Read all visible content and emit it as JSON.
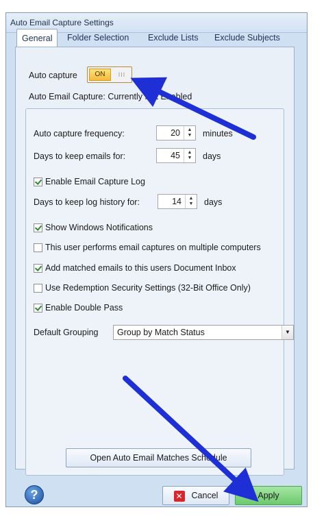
{
  "window": {
    "title": "Auto Email Capture Settings"
  },
  "tabs": [
    {
      "label": "General",
      "active": true
    },
    {
      "label": "Folder Selection",
      "active": false
    },
    {
      "label": "Exclude Lists",
      "active": false
    },
    {
      "label": "Exclude Subjects",
      "active": false
    }
  ],
  "general": {
    "auto_capture_label": "Auto capture",
    "toggle": {
      "on_label": "ON",
      "off_label": "III",
      "state": "on"
    },
    "status_text": "Auto Email Capture: Currently Not Enabled",
    "frequency": {
      "label": "Auto capture frequency:",
      "value": "20",
      "unit": "minutes"
    },
    "days_keep_emails": {
      "label": "Days to keep emails for:",
      "value": "45",
      "unit": "days"
    },
    "enable_log": {
      "label": "Enable Email Capture Log",
      "checked": true
    },
    "days_keep_log": {
      "label": "Days to keep log history for:",
      "value": "14",
      "unit": "days"
    },
    "options": [
      {
        "label": "Show Windows Notifications",
        "checked": true
      },
      {
        "label": "This user performs email captures on multiple computers",
        "checked": false
      },
      {
        "label": "Add matched emails to this users Document Inbox",
        "checked": true
      },
      {
        "label": "Use Redemption Security Settings (32-Bit Office Only)",
        "checked": false
      },
      {
        "label": "Enable Double Pass",
        "checked": true
      }
    ],
    "default_grouping": {
      "label": "Default Grouping",
      "value": "Group by Match Status"
    },
    "schedule_button": "Open Auto Email Matches Schedule"
  },
  "footer": {
    "help_icon": "?",
    "cancel_label": "Cancel",
    "apply_label": "Apply"
  },
  "colors": {
    "apply_bg": "#7fd37f",
    "arrow": "#1f2fd6",
    "toggle_on": "#f6b93b"
  }
}
